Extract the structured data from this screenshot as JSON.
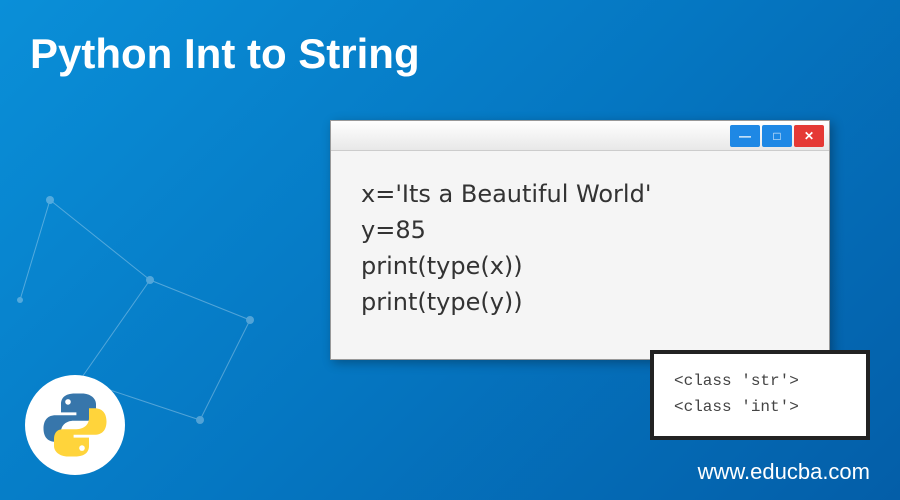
{
  "title": "Python Int to String",
  "code": {
    "line1": "x='Its a Beautiful World'",
    "line2": "y=85",
    "line3": "print(type(x))",
    "line4": "print(type(y))"
  },
  "output": {
    "line1": "<class 'str'>",
    "line2": "<class 'int'>"
  },
  "window_controls": {
    "minimize": "—",
    "maximize": "□",
    "close": "✕"
  },
  "website": "www.educba.com"
}
